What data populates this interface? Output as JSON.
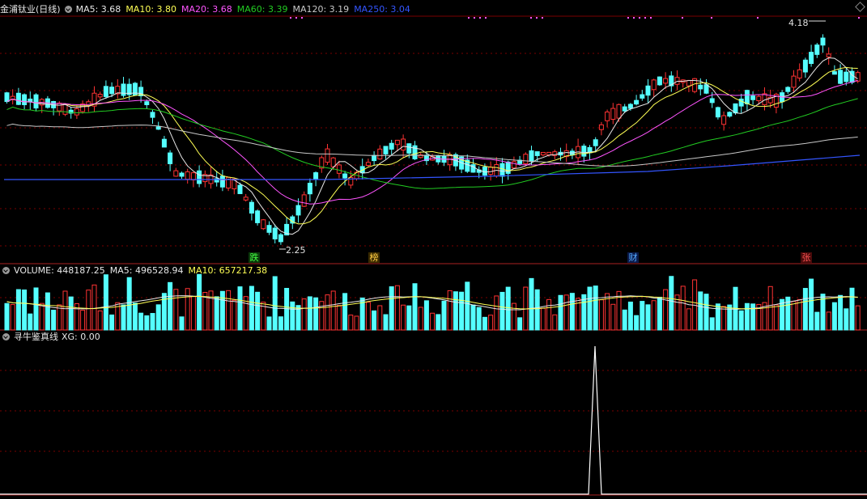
{
  "stock": {
    "title": "金浦钛业(日线)"
  },
  "price_header": {
    "items": [
      {
        "label": "MA5: 3.68",
        "color": "#e8e8e8"
      },
      {
        "label": "MA10: 3.80",
        "color": "#ffff55"
      },
      {
        "label": "MA20: 3.68",
        "color": "#ff55ff"
      },
      {
        "label": "MA60: 3.39",
        "color": "#22cc22"
      },
      {
        "label": "MA120: 3.19",
        "color": "#c8c8c8"
      },
      {
        "label": "MA250: 3.04",
        "color": "#3355ff"
      }
    ]
  },
  "price_panel": {
    "high_label": "4.18",
    "low_label": "2.25",
    "badges": [
      {
        "text": "跌",
        "color": "#44ff44"
      },
      {
        "text": "榜",
        "color": "#ffcc44"
      },
      {
        "text": "财",
        "color": "#55aaff"
      },
      {
        "text": "张",
        "color": "#ff5555"
      }
    ]
  },
  "volume_header": {
    "items": [
      {
        "label": "VOLUME: 448187.25",
        "color": "#e8e8e8"
      },
      {
        "label": "MA5: 496528.94",
        "color": "#e8e8e8"
      },
      {
        "label": "MA10: 657217.38",
        "color": "#ffff55"
      }
    ]
  },
  "indicator_header": {
    "items": [
      {
        "label": "寻牛鉴真线",
        "color": "#e8e8e8"
      },
      {
        "label": "XG: 0.00",
        "color": "#e8e8e8"
      }
    ]
  },
  "colors": {
    "up": "#ff3333",
    "down": "#55ffff",
    "grid": "#7a0000",
    "frame": "#aa2222"
  },
  "chart_data": {
    "type": "candlestick",
    "title": "金浦钛业(日线)",
    "visible_price_range": [
      2.25,
      4.18
    ],
    "ma_last": {
      "MA5": 3.68,
      "MA10": 3.8,
      "MA20": 3.68,
      "MA60": 3.39,
      "MA120": 3.19,
      "MA250": 3.04
    },
    "volume_last": 448187.25,
    "volume_ma_last": {
      "MA5": 496528.94,
      "MA10": 657217.38
    },
    "indicator": {
      "name": "寻牛鉴真线",
      "XG": 0.0
    }
  }
}
